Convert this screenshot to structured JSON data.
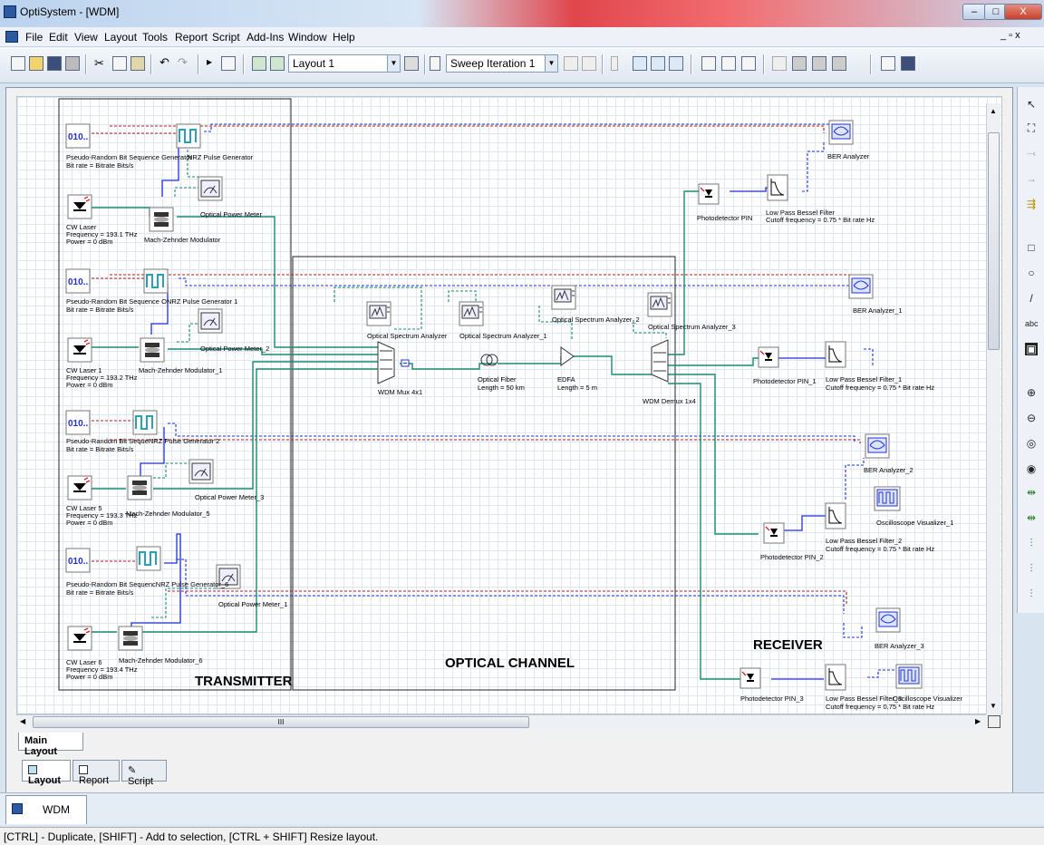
{
  "window": {
    "title": "OptiSystem - [WDM]",
    "min": "–",
    "max": "□",
    "close": "X"
  },
  "menu": [
    "File",
    "Edit",
    "View",
    "Layout",
    "Tools",
    "Report",
    "Script",
    "Add-Ins",
    "Window",
    "Help"
  ],
  "toolbar": {
    "layout_combo": "Layout 1",
    "sweep_combo": "Sweep Iteration 1"
  },
  "regions": {
    "transmitter": "TRANSMITTER",
    "channel": "OPTICAL CHANNEL",
    "receiver": "RECEIVER"
  },
  "components": {
    "prbs0": "Pseudo-Random Bit Sequence Generator",
    "prbs0_p": "Bit rate = Bitrate Bits/s",
    "nrz0": "NRZ Pulse Generator",
    "laser0": "CW Laser",
    "laser0_p1": "Frequency = 193.1 THz",
    "laser0_p2": "Power = 0 dBm",
    "mzm0": "Mach-Zehnder Modulator",
    "opm0": "Optical Power Meter",
    "prbs1": "Pseudo-Random Bit Sequence ONRZ Pulse Generator 1",
    "prbs1_p": "Bit rate = Bitrate Bits/s",
    "laser1": "CW Laser 1",
    "laser1_p1": "Frequency = 193.2 THz",
    "laser1_p2": "Power = 0 dBm",
    "mzm1": "Mach-Zehnder Modulator_1",
    "opm2": "Optical Power Meter_2",
    "prbs5": "Pseudo-Random Bit SequeNRZ Pulse Generator 2",
    "prbs5_p": "Bit rate = Bitrate Bits/s",
    "laser5": "CW Laser 5",
    "laser5_p1": "Frequency = 193.3 THz",
    "laser5_p2": "Power = 0 dBm",
    "mzm5": "Mach-Zehnder Modulator_5",
    "opm3": "Optical Power Meter_3",
    "prbs6": "Pseudo-Random Bit SequencNRZ Pulse Generator_6",
    "prbs6_p": "Bit rate = Bitrate Bits/s",
    "opm1": "Optical Power Meter_1",
    "laser6": "CW Laser 6",
    "laser6_p1": "Frequency = 193.4 THz",
    "laser6_p2": "Power = 0 dBm",
    "mzm6": "Mach-Zehnder Modulator_6",
    "osa0": "Optical Spectrum Analyzer",
    "osa1": "Optical Spectrum Analyzer_1",
    "osa2": "Optical Spectrum Analyzer_2",
    "osa3": "Optical Spectrum Analyzer_3",
    "mux": "WDM Mux 4x1",
    "fiber": "Optical Fiber",
    "fiber_p": "Length = 50 km",
    "edfa": "EDFA",
    "edfa_p": "Length = 5 m",
    "demux": "WDM Demux 1x4",
    "pd0": "Photodetector PIN",
    "lpf0": "Low Pass Bessel Filter",
    "lpf0_p": "Cutoff frequency = 0.75 * Bit rate Hz",
    "ber0": "BER Analyzer",
    "pd1": "Photodetector PIN_1",
    "lpf1": "Low Pass Bessel Filter_1",
    "lpf1_p": "Cutoff frequency = 0.75 * Bit rate Hz",
    "ber1": "BER Analyzer_1",
    "pd2": "Photodetector PIN_2",
    "lpf2": "Low Pass Bessel Filter_2",
    "lpf2_p": "Cutoff frequency = 0.75 * Bit rate Hz",
    "ber2": "BER Analyzer_2",
    "osc1": "Oscilloscope Visualizer_1",
    "pd3": "Photodetector PIN_3",
    "lpf3": "Low Pass Bessel Filter_3",
    "lpf3_p": "Cutoff frequency = 0.75 * Bit rate Hz",
    "ber3": "BER Analyzer_3",
    "osc0": "Oscilloscope Visualizer",
    "bits": "010.."
  },
  "hscroll_label": "III",
  "tabs": {
    "main_layout": "Main Layout",
    "layout": "Layout",
    "report": "Report",
    "script": "Script",
    "doc": "WDM"
  },
  "status": "[CTRL] - Duplicate, [SHIFT] - Add to selection, [CTRL + SHIFT] Resize layout.",
  "colors": {
    "optical": "#1a8a72",
    "electrical": "#1f2fd0",
    "bitstream": "#b01818",
    "monitor": "#1a8a72"
  }
}
